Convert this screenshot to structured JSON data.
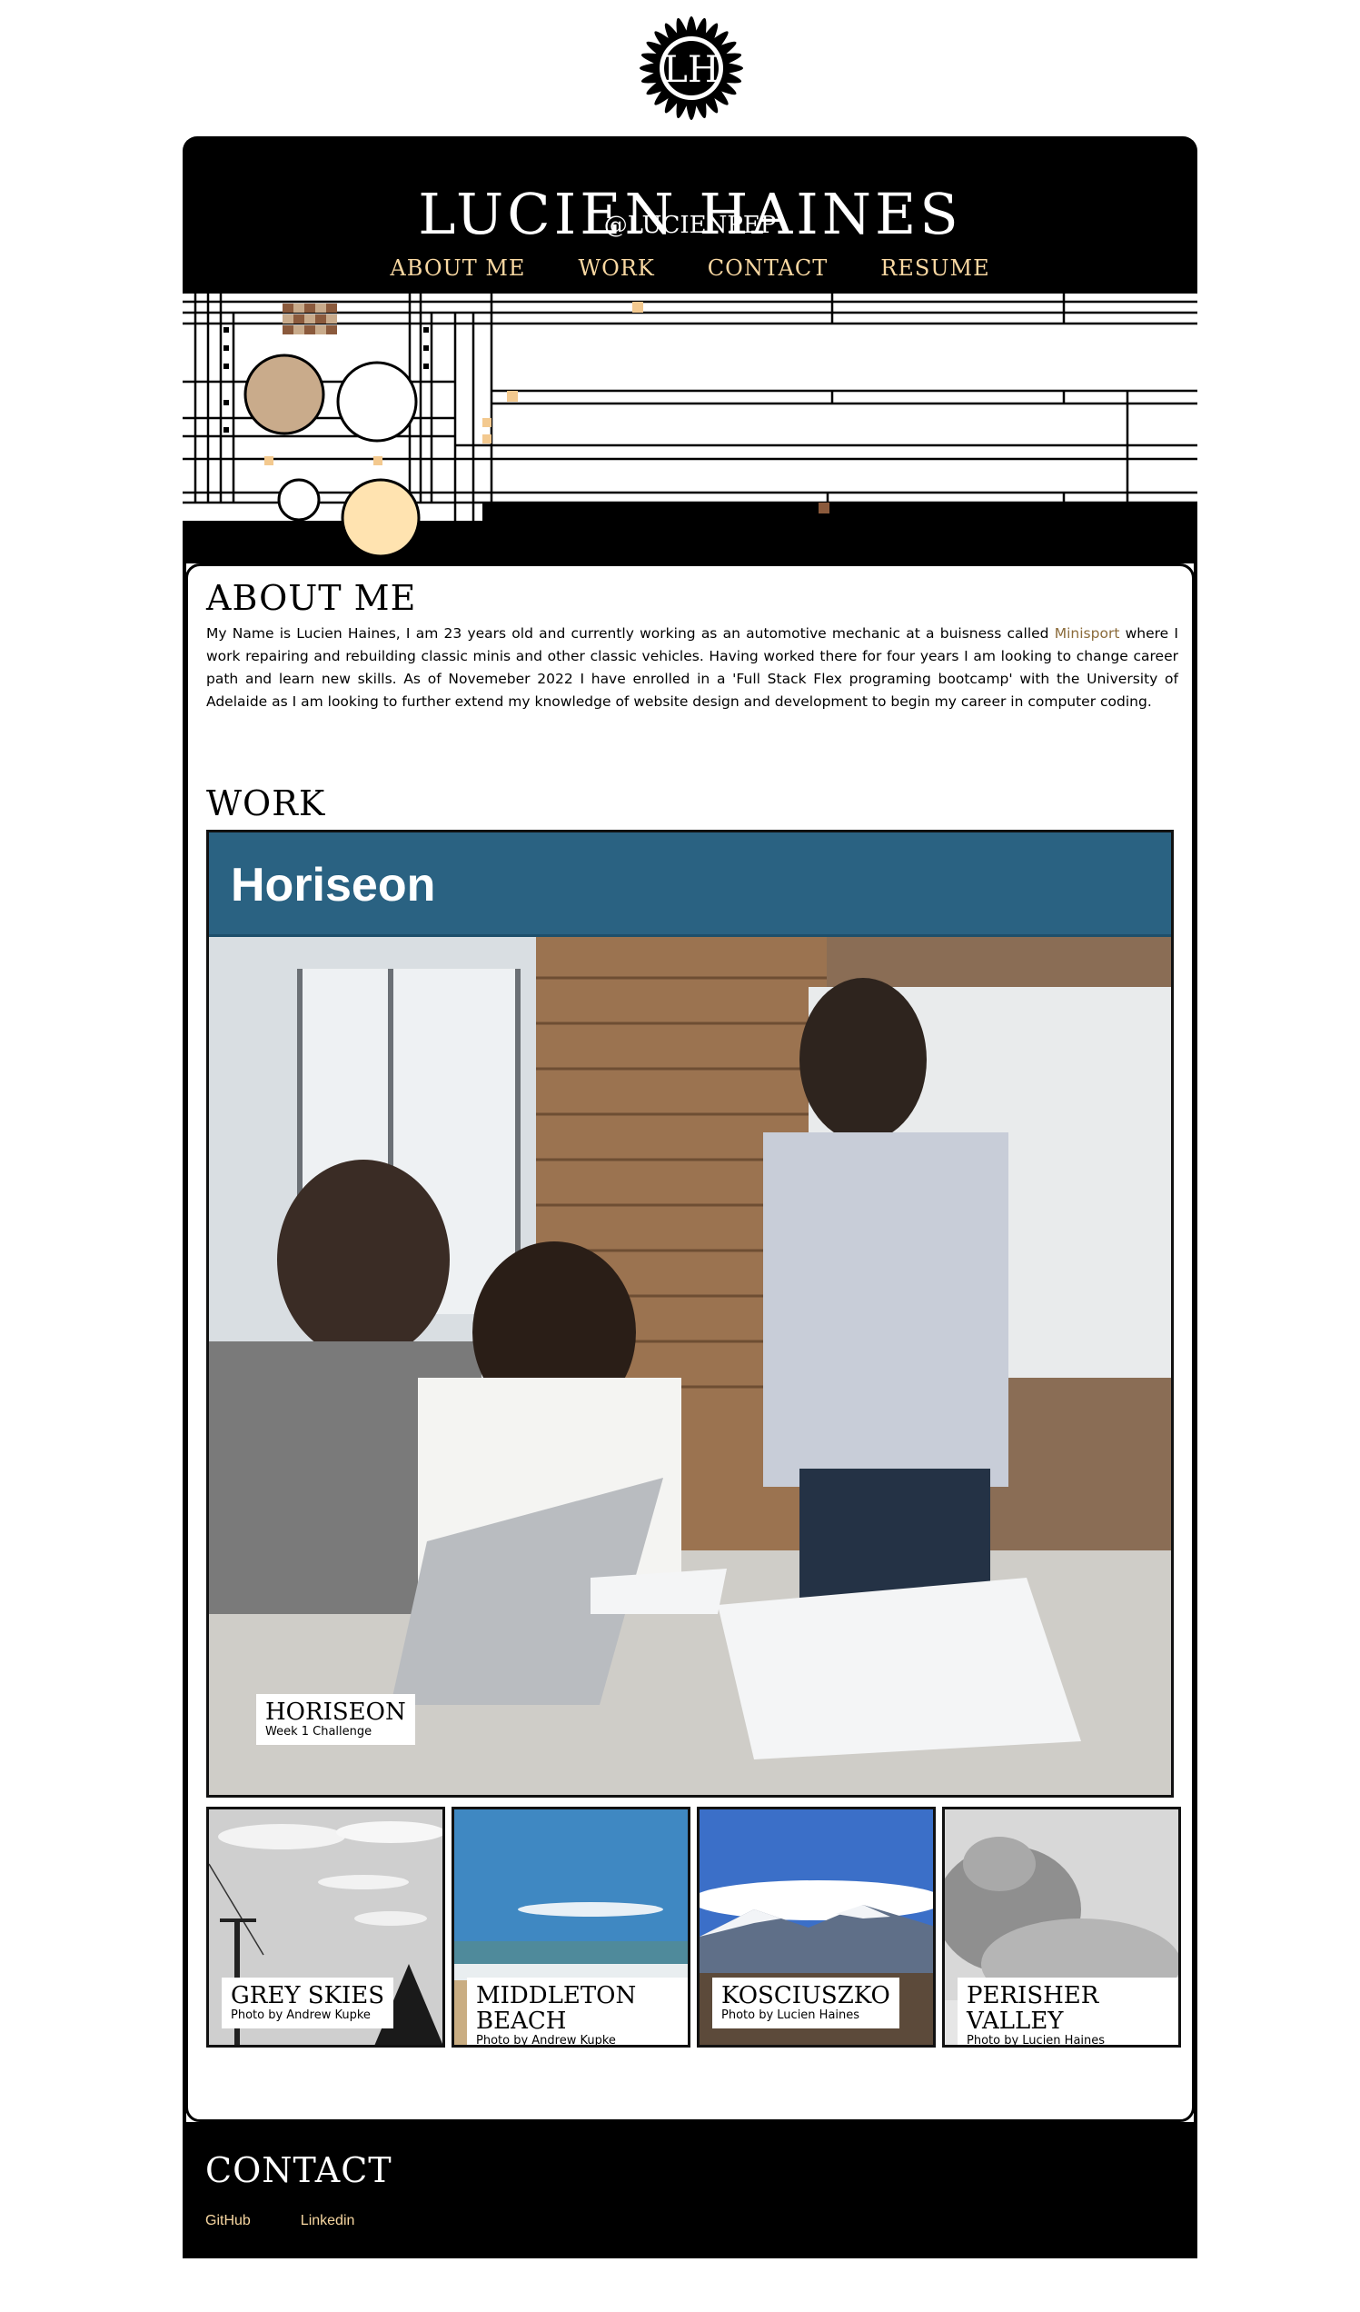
{
  "header": {
    "title": "LUCIEN HAINES",
    "handle": "@LUCIENPEP",
    "logo_monogram": "LH"
  },
  "nav": {
    "items": [
      {
        "label": "ABOUT ME"
      },
      {
        "label": "WORK"
      },
      {
        "label": "CONTACT"
      },
      {
        "label": "RESUME"
      }
    ]
  },
  "colors": {
    "accent": "#f8d7a1",
    "background": "#000000",
    "link": "#8b6b3a",
    "tan_circle": "#c9ab8b",
    "cream_circle": "#ffe3b0",
    "check_brown": "#8b5a3c",
    "hero_banner": "#2a6282"
  },
  "about": {
    "title": "ABOUT ME",
    "text_before_link": "My Name is Lucien Haines, I am 23 years old and currently working as an automotive mechanic at a buisness called ",
    "link_text": "Minisport",
    "text_after_link": " where I work repairing and rebuilding classic minis and other classic vehicles. Having worked there for four years I am looking to change career path and learn new skills. As of Novemeber 2022 I have enrolled in a 'Full Stack Flex programing bootcamp' with the University of Adelaide as I am looking to further extend my knowledge of website design and development to begin my career in computer coding."
  },
  "work": {
    "title": "WORK",
    "featured": {
      "banner_text": "Horiseon",
      "title": "HORISEON",
      "subtitle": "Week 1 Challenge"
    },
    "projects": [
      {
        "title": "GREY SKIES",
        "subtitle": "Photo by Andrew Kupke"
      },
      {
        "title": "MIDDLETON BEACH",
        "subtitle": "Photo by Andrew Kupke"
      },
      {
        "title": "KOSCIUSZKO",
        "subtitle": "Photo by Lucien Haines"
      },
      {
        "title": "PERISHER VALLEY",
        "subtitle": "Photo by Lucien Haines"
      }
    ]
  },
  "contact": {
    "title": "CONTACT",
    "links": [
      {
        "label": "GitHub"
      },
      {
        "label": "Linkedin"
      }
    ]
  }
}
